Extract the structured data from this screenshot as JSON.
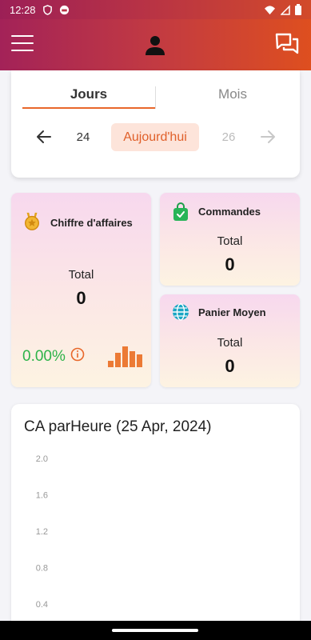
{
  "status_bar": {
    "time": "12:28"
  },
  "tabs": {
    "days": "Jours",
    "months": "Mois"
  },
  "day_nav": {
    "prev_day": "24",
    "today": "Aujourd'hui",
    "next_day": "26"
  },
  "cards": {
    "revenue": {
      "title": "Chiffre d'affaires",
      "total_label": "Total",
      "total_value": "0",
      "percent": "0.00%"
    },
    "orders": {
      "title": "Commandes",
      "total_label": "Total",
      "total_value": "0"
    },
    "avg_cart": {
      "title": "Panier Moyen",
      "total_label": "Total",
      "total_value": "0"
    }
  },
  "colors": {
    "accent": "#e8672a",
    "positive": "#2db34a"
  },
  "chart_data": {
    "type": "bar",
    "title": "CA parHeure (25 Apr, 2024)",
    "categories": [],
    "values": [],
    "ylim": [
      0,
      2.0
    ],
    "y_ticks": [
      "2.0",
      "1.6",
      "1.2",
      "0.8",
      "0.4"
    ],
    "xlabel": "",
    "ylabel": ""
  }
}
